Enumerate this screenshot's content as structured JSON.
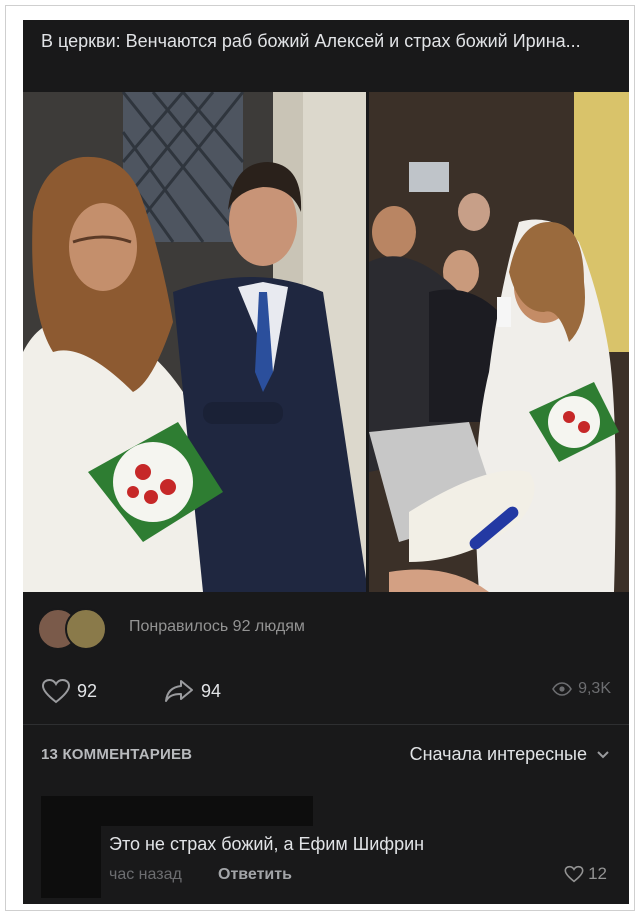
{
  "post": {
    "caption": "В церкви: Венчаются раб божий Алексей и страх божий Ирина...",
    "liked_text": "Понравилось 92 людям",
    "likes": "92",
    "shares": "94",
    "views": "9,3K"
  },
  "comments": {
    "count_label": "13 КОММЕНТАРИЕВ",
    "sort_label": "Сначала интересные",
    "items": [
      {
        "text": "Это не страх божий, а Ефим Шифрин",
        "time": "час назад",
        "reply": "Ответить",
        "likes": "12"
      }
    ]
  },
  "colors": {
    "background": "#19191a",
    "text": "#e1e3e6",
    "muted": "#939393"
  },
  "icons": [
    "heart-icon",
    "share-icon",
    "eye-icon",
    "chevron-down-icon"
  ]
}
